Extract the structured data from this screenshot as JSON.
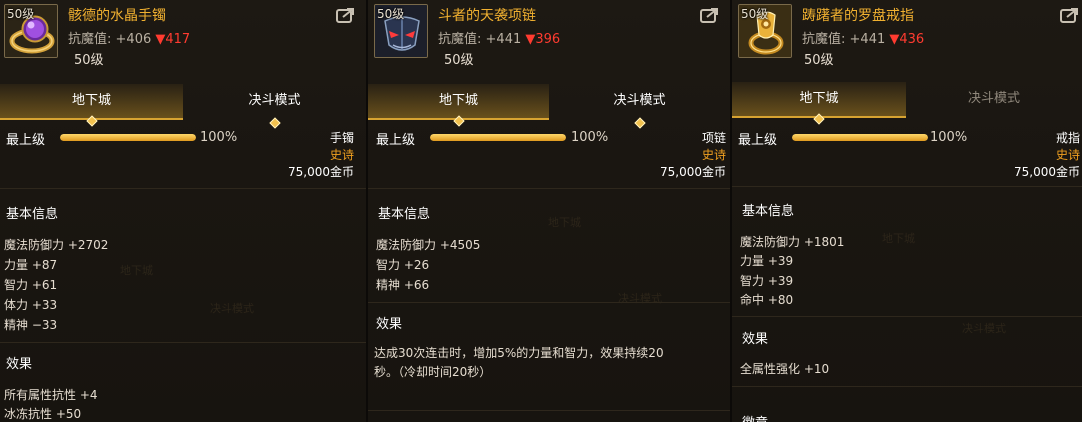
{
  "panels": [
    {
      "level_badge": "50级",
      "name": "骸德的水晶手镯",
      "resist_label": "抗魔值:",
      "resist_plus": "+406",
      "resist_down": "▼417",
      "level": "50级",
      "tabs": [
        {
          "label": "地下城",
          "active": true
        },
        {
          "label": "决斗模式",
          "active": false
        }
      ],
      "max_level_label": "最上级",
      "progress": 1.0,
      "progress_text": "100%",
      "slot": "手镯",
      "rarity": "史诗",
      "price": "75,000金币",
      "basic_title": "基本信息",
      "stats": [
        "魔法防御力 +2702",
        "力量 +87",
        "智力 +61",
        "体力 +33",
        "精神 −33"
      ],
      "effect_title": "效果",
      "effects": [
        "所有属性抗性 +4",
        "冰冻抗性 +50"
      ]
    },
    {
      "level_badge": "50级",
      "name": "斗者的天袭项链",
      "resist_label": "抗魔值:",
      "resist_plus": "+441",
      "resist_down": "▼396",
      "level": "50级",
      "tabs": [
        {
          "label": "地下城",
          "active": true
        },
        {
          "label": "决斗模式",
          "active": false
        }
      ],
      "max_level_label": "最上级",
      "progress": 1.0,
      "progress_text": "100%",
      "slot": "项链",
      "rarity": "史诗",
      "price": "75,000金币",
      "basic_title": "基本信息",
      "stats": [
        "魔法防御力 +4505",
        "智力 +26",
        "精神 +66"
      ],
      "effect_title": "效果",
      "effect_desc_1": "达成30次连击时，增加5%的力量和智力，效果持续20",
      "effect_desc_2": "秒。（冷却时间20秒）"
    },
    {
      "level_badge": "50级",
      "name": "踌躇者的罗盘戒指",
      "resist_label": "抗魔值:",
      "resist_plus": "+441",
      "resist_down": "▼436",
      "level": "50级",
      "tabs": [
        {
          "label": "地下城",
          "active": true
        },
        {
          "label": "决斗模式",
          "active": false
        }
      ],
      "max_level_label": "最上级",
      "progress": 1.0,
      "progress_text": "100%",
      "slot": "戒指",
      "rarity": "史诗",
      "price": "75,000金币",
      "basic_title": "基本信息",
      "stats": [
        "魔法防御力 +1801",
        "力量 +39",
        "智力 +39",
        "命中 +80"
      ],
      "effect_title": "效果",
      "effects": [
        "全属性强化 +10"
      ],
      "next_title": "徽章"
    }
  ],
  "icons": {
    "item_1": "purple-crystal-bracelet-icon",
    "item_2": "blue-mask-necklace-icon",
    "item_3": "golden-compass-ring-icon",
    "share": "share-arrow-icon"
  },
  "colors": {
    "item_name": "#f0b030",
    "rarity_epic": "#f0a020",
    "decrease": "#ff3b30",
    "tab_active_underline": "#d7a331"
  }
}
